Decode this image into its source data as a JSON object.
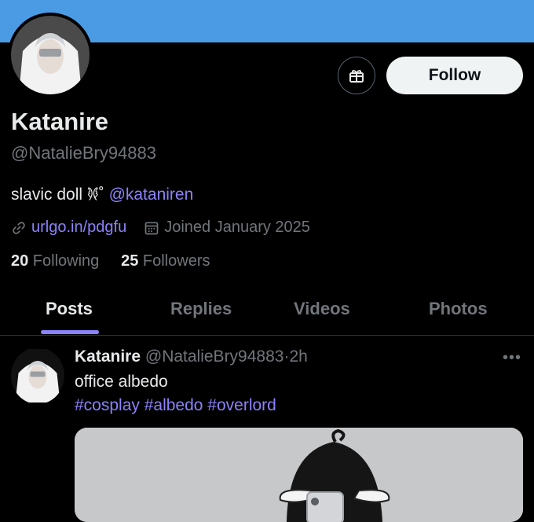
{
  "profile": {
    "name": "Katanire",
    "handle": "@NatalieBry94883",
    "bio_text": "slavic doll 𐦍˚ ",
    "bio_mention": "@kataniren",
    "link": "urlgo.in/pdgfu",
    "joined": "Joined January 2025",
    "following_count": "20",
    "following_label": " Following",
    "followers_count": "25",
    "followers_label": " Followers"
  },
  "actions": {
    "follow_label": "Follow"
  },
  "tabs": [
    "Posts",
    "Replies",
    "Videos",
    "Photos"
  ],
  "post": {
    "name": "Katanire",
    "handle": "@NatalieBry94883",
    "time": "2h",
    "separator": "·",
    "text": "office albedo",
    "hashtags": "#cosplay #albedo #overlord",
    "more": "•••"
  },
  "colors": {
    "banner": "#4a9be3",
    "accent": "#8c82f9",
    "muted": "#71767b"
  },
  "icons": [
    "gift-icon",
    "link-icon",
    "calendar-icon",
    "more-icon"
  ]
}
